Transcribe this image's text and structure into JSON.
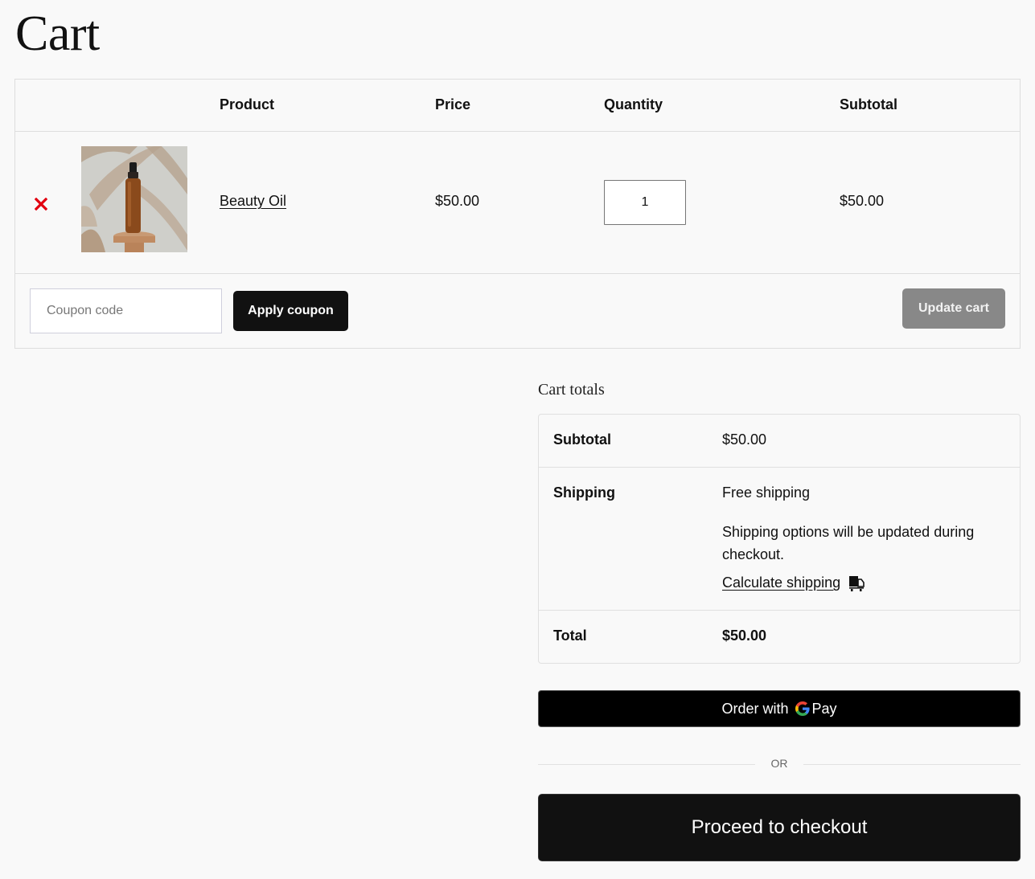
{
  "page": {
    "title": "Cart"
  },
  "cart_table": {
    "headers": {
      "product": "Product",
      "price": "Price",
      "quantity": "Quantity",
      "subtotal": "Subtotal"
    },
    "items": [
      {
        "remove_icon": "close-icon",
        "image_alt": "Beauty Oil",
        "name": "Beauty Oil",
        "price": "$50.00",
        "quantity": "1",
        "subtotal": "$50.00"
      }
    ],
    "remove_color": "#e2000f"
  },
  "actions": {
    "coupon_placeholder": "Coupon code",
    "coupon_value": "",
    "apply_coupon_label": "Apply coupon",
    "update_cart_label": "Update cart"
  },
  "totals": {
    "title": "Cart totals",
    "subtotal_label": "Subtotal",
    "subtotal_value": "$50.00",
    "shipping_label": "Shipping",
    "shipping_method": "Free shipping",
    "shipping_note": "Shipping options will be updated during checkout.",
    "calculate_shipping_label": "Calculate shipping",
    "calculate_shipping_icon": "truck-icon",
    "total_label": "Total",
    "total_value": "$50.00"
  },
  "checkout": {
    "gpay_prefix": "Order with",
    "gpay_brand": "Pay",
    "separator": "OR",
    "proceed_label": "Proceed to checkout"
  }
}
